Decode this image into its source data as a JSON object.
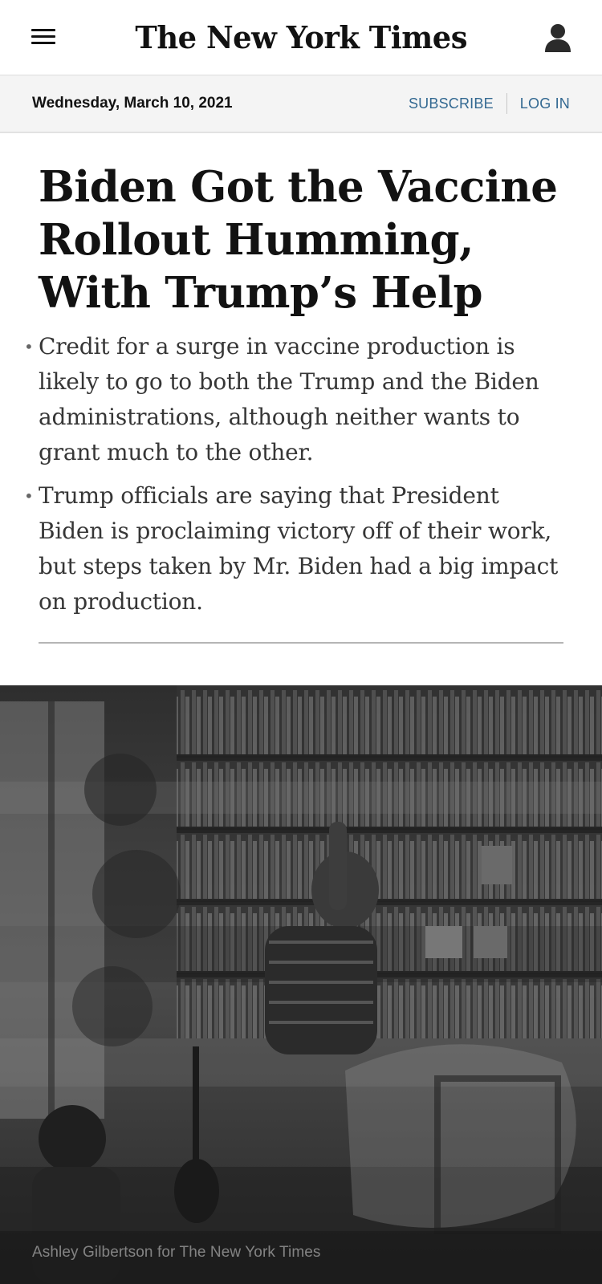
{
  "header": {
    "logo": "The New York Times",
    "menu_icon": "hamburger-menu-icon",
    "account_icon": "user-account-icon"
  },
  "datebar": {
    "date": "Wednesday, March 10, 2021",
    "subscribe": "SUBSCRIBE",
    "login": "LOG IN"
  },
  "article": {
    "headline": "Biden Got the Vaccine Rollout Humming, With Trump’s Help",
    "summary": [
      "Credit for a surge in vaccine production is likely to go to both the Trump and the Biden administrations, although neither wants to grant much to the other.",
      "Trump officials are saying that President Biden is proclaiming victory off of their work, but steps taken by Mr. Biden had a big impact on production."
    ],
    "photo_caption": "Ashley Gilbertson for The New York Times"
  },
  "colors": {
    "link": "#326891",
    "datebar_bg": "#f4f4f4",
    "text": "#121212"
  }
}
